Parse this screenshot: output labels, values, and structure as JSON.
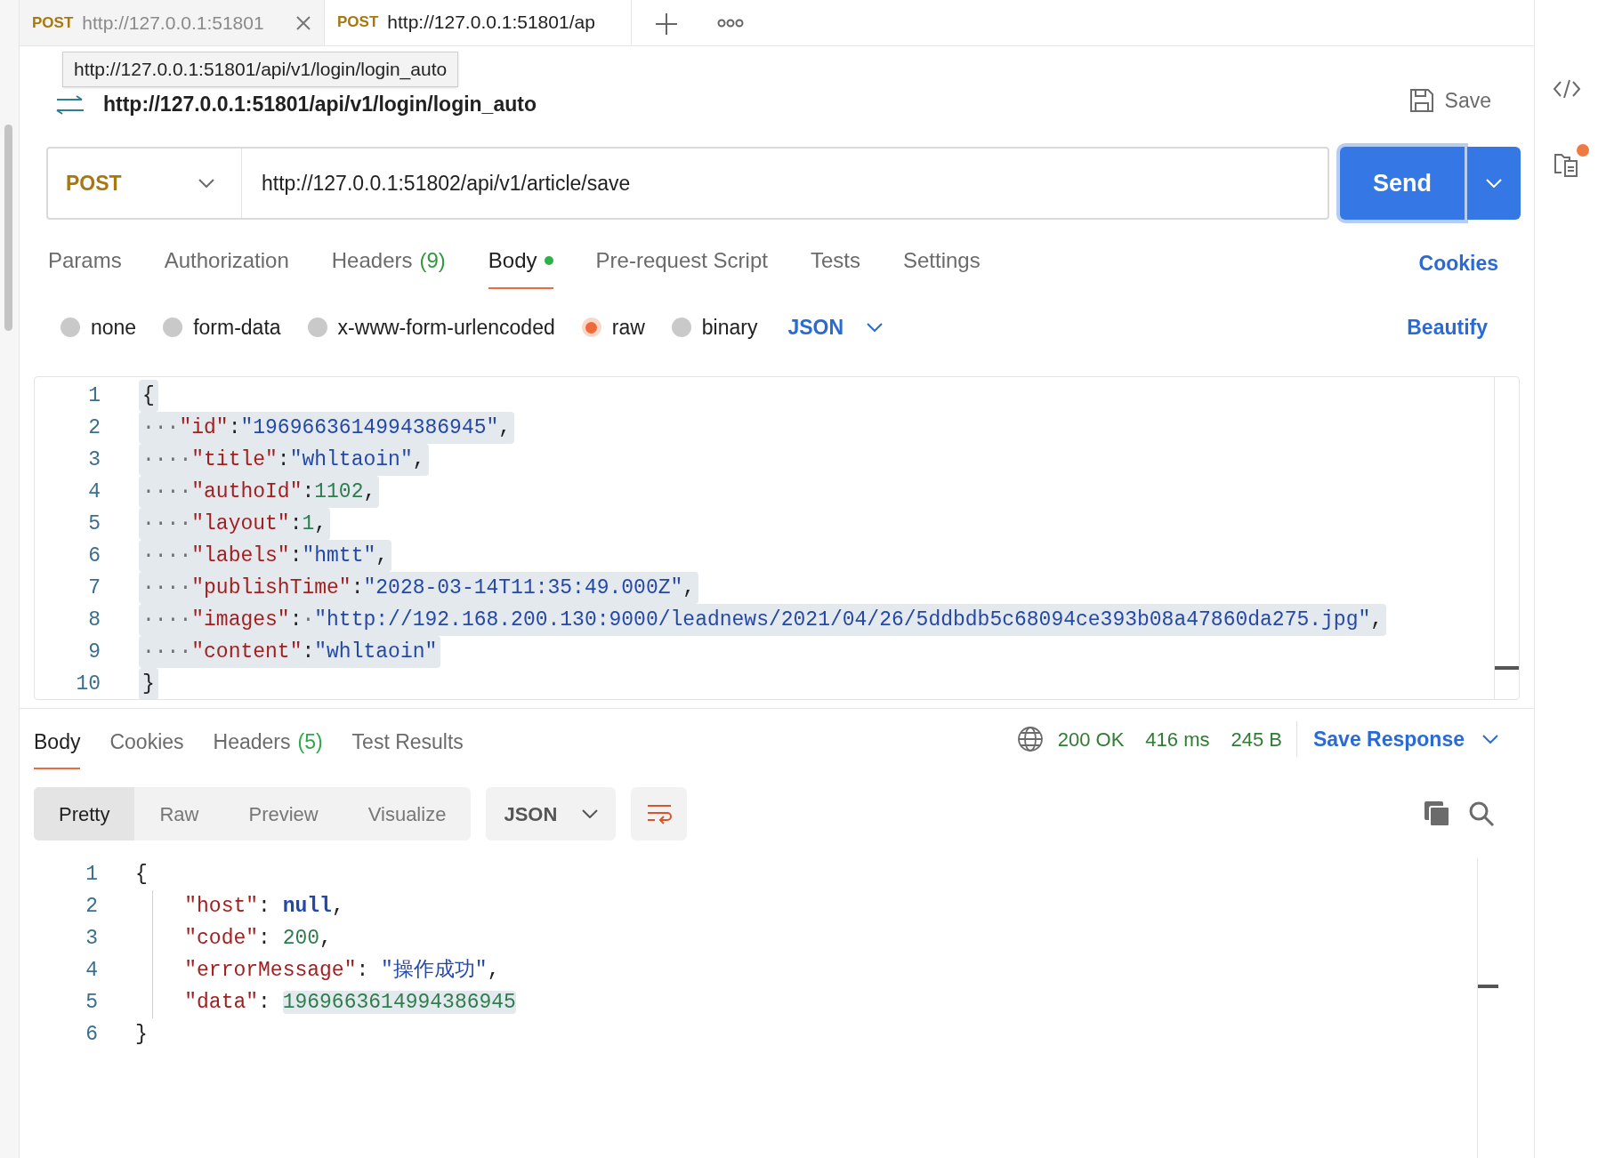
{
  "tabs": [
    {
      "method": "POST",
      "url": "http://127.0.0.1:51801",
      "selected": false,
      "closable": true
    },
    {
      "method": "POST",
      "url": "http://127.0.0.1:51801/ap",
      "selected": true,
      "closable": false
    }
  ],
  "request": {
    "title": "http://127.0.0.1:51801/api/v1/login/login_auto",
    "tooltip": "http://127.0.0.1:51801/api/v1/login/login_auto",
    "save": "Save",
    "method": "POST",
    "url": "http://127.0.0.1:51802/api/v1/article/save",
    "send": "Send"
  },
  "request_tabs": [
    {
      "label": "Params",
      "selected": false
    },
    {
      "label": "Authorization",
      "selected": false
    },
    {
      "label": "Headers",
      "count": "(9)",
      "selected": false
    },
    {
      "label": "Body",
      "selected": true,
      "dot": true
    },
    {
      "label": "Pre-request Script",
      "selected": false
    },
    {
      "label": "Tests",
      "selected": false
    },
    {
      "label": "Settings",
      "selected": false
    }
  ],
  "cookies": "Cookies",
  "body_types": [
    {
      "label": "none",
      "selected": false
    },
    {
      "label": "form-data",
      "selected": false
    },
    {
      "label": "x-www-form-urlencoded",
      "selected": false
    },
    {
      "label": "raw",
      "selected": true
    },
    {
      "label": "binary",
      "selected": false
    }
  ],
  "body_format": "JSON",
  "beautify": "Beautify",
  "request_body": {
    "selected": true,
    "lines": [
      {
        "number": "1",
        "text": "{"
      },
      {
        "number": "2",
        "text": "···\"id\":\"1969663614994386945\","
      },
      {
        "number": "3",
        "text": "····\"title\":\"whltaoin\","
      },
      {
        "number": "4",
        "text": "····\"authoId\":1102,"
      },
      {
        "number": "5",
        "text": "····\"layout\":1,"
      },
      {
        "number": "6",
        "text": "····\"labels\":\"hmtt\","
      },
      {
        "number": "7",
        "text": "····\"publishTime\":\"2028-03-14T11:35:49.000Z\","
      },
      {
        "number": "8",
        "text": "····\"images\":·\"http://192.168.200.130:9000/leadnews/2021/04/26/5ddbdb5c68094ce393b08a47860da275.jpg\","
      },
      {
        "number": "9",
        "text": "····\"content\":\"whltaoin\""
      },
      {
        "number": "10",
        "text": "}"
      }
    ]
  },
  "response_tabs": [
    {
      "label": "Body",
      "selected": true
    },
    {
      "label": "Cookies",
      "selected": false
    },
    {
      "label": "Headers",
      "count": "(5)",
      "selected": false
    },
    {
      "label": "Test Results",
      "selected": false
    }
  ],
  "status": {
    "code": "200 OK",
    "time": "416 ms",
    "size": "245 B"
  },
  "save_response": "Save Response",
  "view_modes": [
    {
      "label": "Pretty",
      "selected": true
    },
    {
      "label": "Raw",
      "selected": false
    },
    {
      "label": "Preview",
      "selected": false
    },
    {
      "label": "Visualize",
      "selected": false
    }
  ],
  "response_format": "JSON",
  "response_body": {
    "lines": [
      {
        "number": "1",
        "text": "{",
        "highlighted": false
      },
      {
        "number": "2",
        "text": "    \"host\": null,",
        "highlighted": false
      },
      {
        "number": "3",
        "text": "    \"code\": 200,",
        "highlighted": false
      },
      {
        "number": "4",
        "text": "    \"errorMessage\": \"操作成功\",",
        "highlighted": false
      },
      {
        "number": "5",
        "text": "    \"data\": 1969663614994386945",
        "highlighted": true
      },
      {
        "number": "6",
        "text": "}",
        "highlighted": false
      }
    ]
  }
}
